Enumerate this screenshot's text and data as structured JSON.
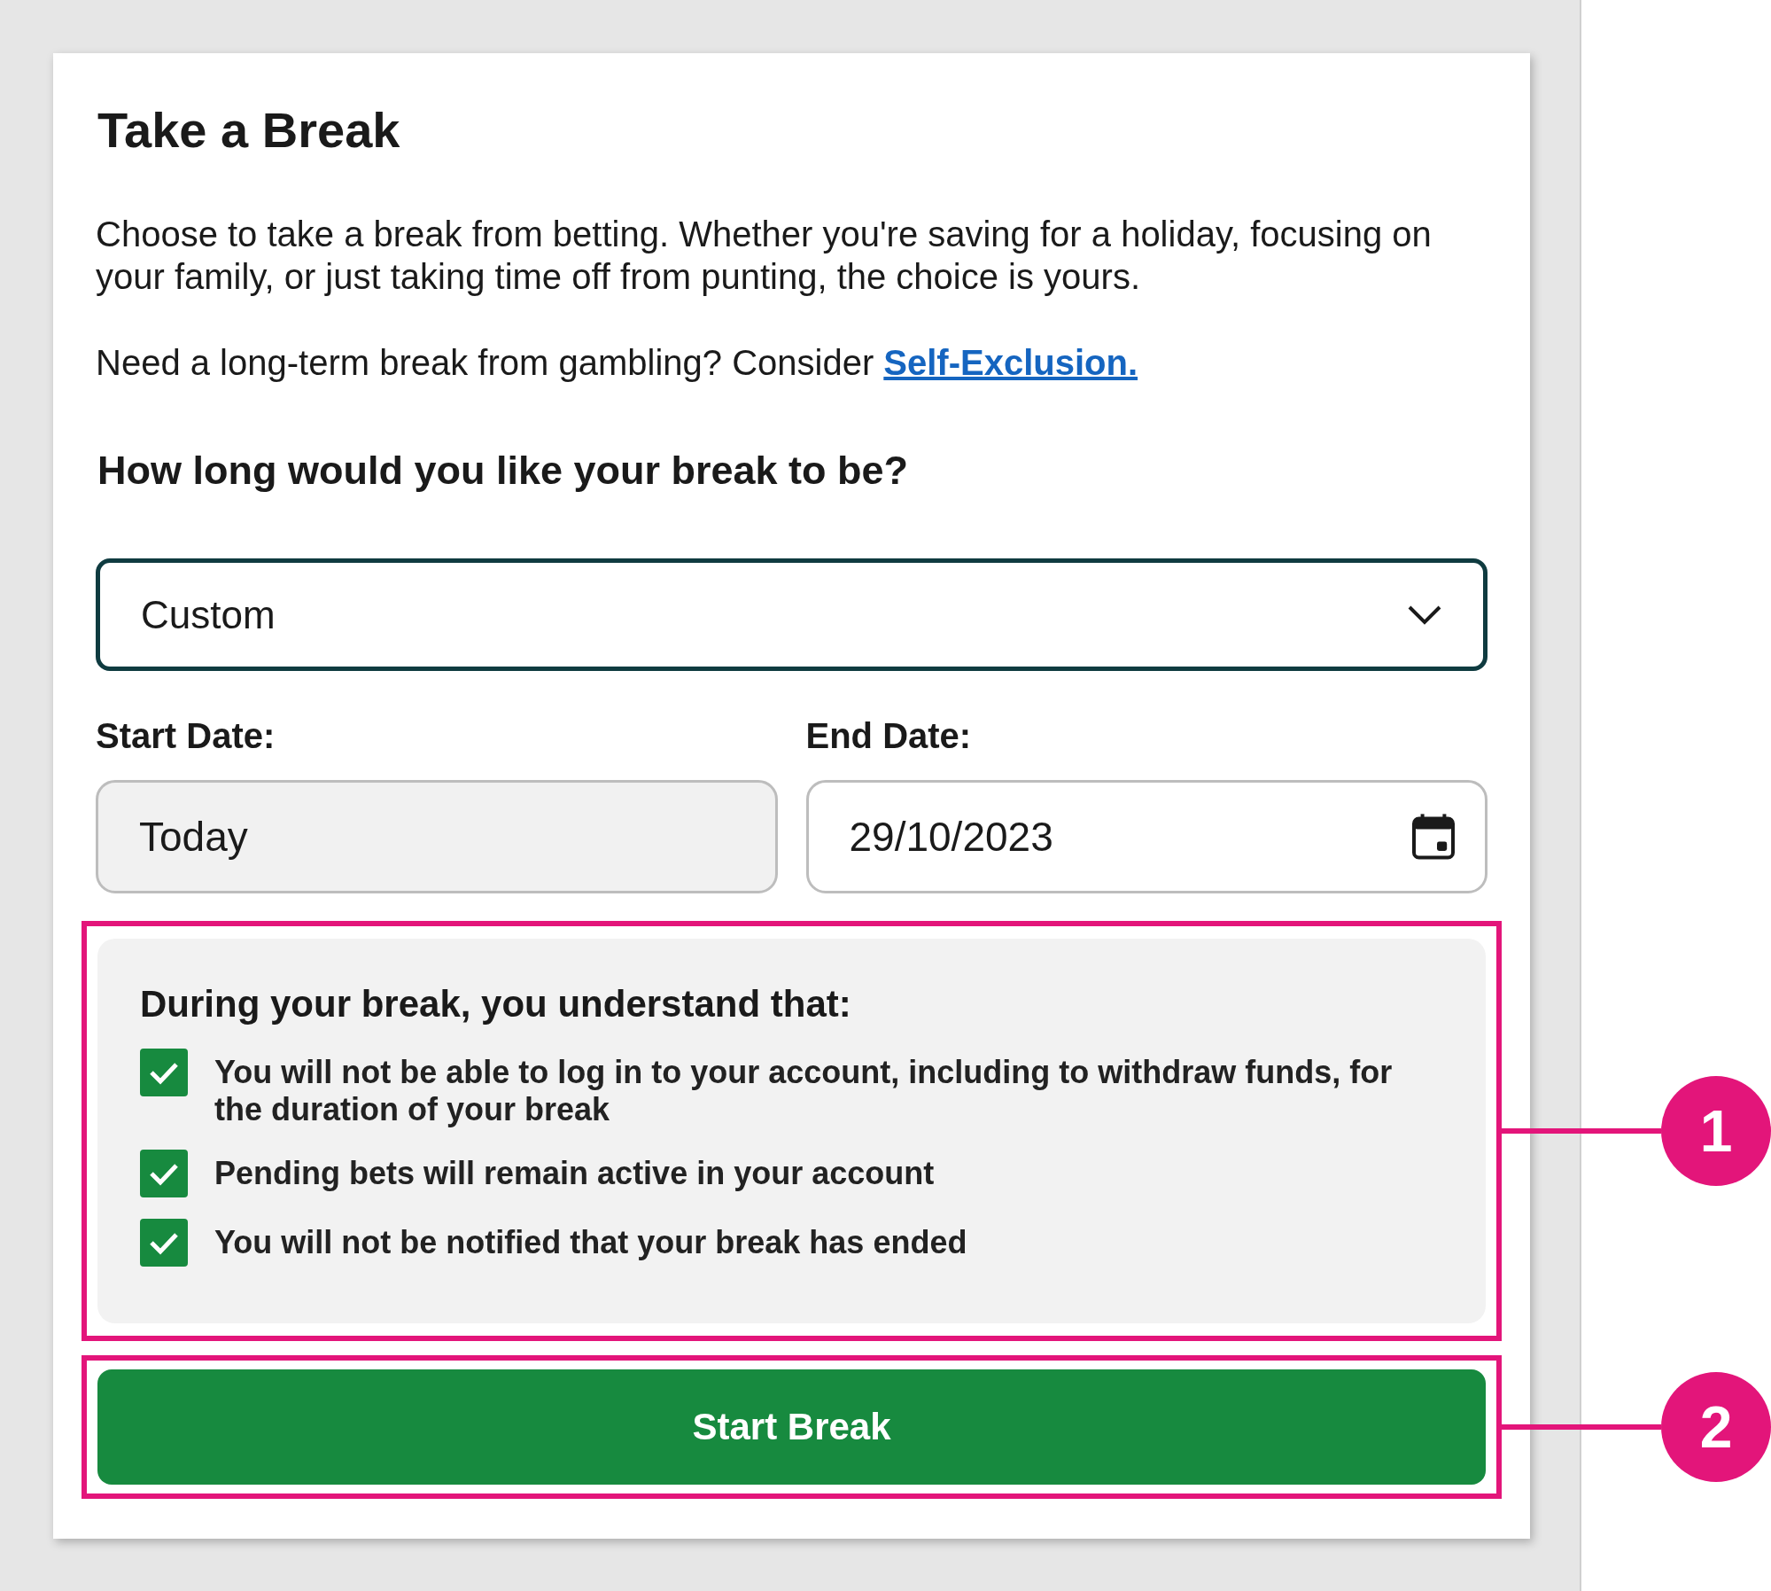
{
  "title": "Take a Break",
  "intro": "Choose to take a break from betting. Whether you're saving for a holiday, focusing on your family, or just taking time off from punting, the choice is yours.",
  "exclusion_note": {
    "text": "Need a long-term break from gambling? Consider",
    "link": "Self-Exclusion."
  },
  "question": "How long would you like your break to be?",
  "duration_select": {
    "value": "Custom"
  },
  "start_date": {
    "label": "Start Date:",
    "value": "Today",
    "disabled": true
  },
  "end_date": {
    "label": "End Date:",
    "value": "29/10/2023"
  },
  "conditions": {
    "heading": "During your break, you understand that:",
    "items": [
      {
        "text": "You will not be able to log in to your account, including to withdraw funds, for the duration of your break",
        "checked": true
      },
      {
        "text": "Pending bets will remain active in your account",
        "checked": true
      },
      {
        "text": "You will not be notified that your break has ended",
        "checked": true
      }
    ]
  },
  "submit_button": "Start Break",
  "annotations": [
    {
      "number": "1"
    },
    {
      "number": "2"
    }
  ]
}
